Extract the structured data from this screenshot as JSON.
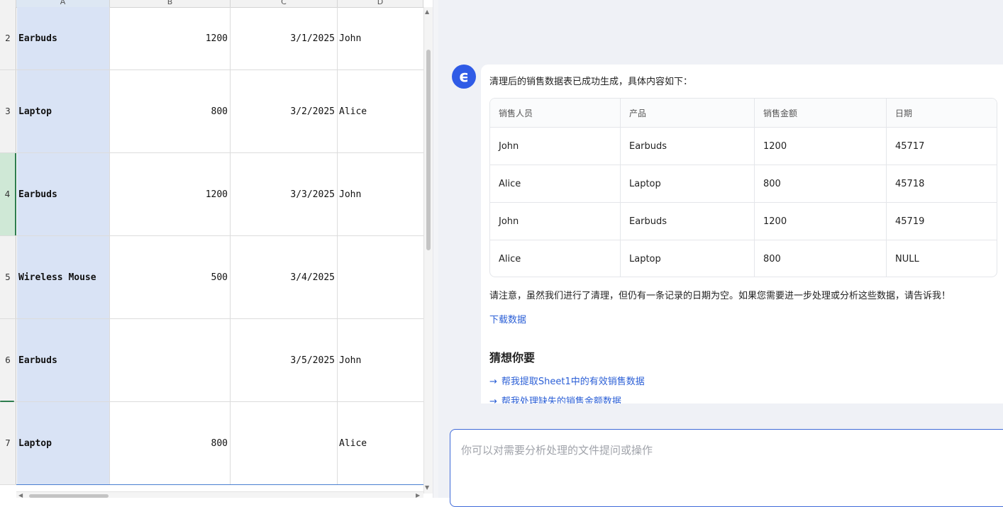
{
  "sheet": {
    "columns": [
      "A",
      "B",
      "C",
      "D"
    ],
    "rows": [
      {
        "num": "2",
        "a": "Earbuds",
        "b": "1200",
        "c": "3/1/2025",
        "d": "John"
      },
      {
        "num": "3",
        "a": "Laptop",
        "b": "800",
        "c": "3/2/2025",
        "d": "Alice"
      },
      {
        "num": "4",
        "a": "Earbuds",
        "b": "1200",
        "c": "3/3/2025",
        "d": "John"
      },
      {
        "num": "5",
        "a": "Wireless Mouse",
        "b": "500",
        "c": "3/4/2025",
        "d": ""
      },
      {
        "num": "6",
        "a": "Earbuds",
        "b": "",
        "c": "3/5/2025",
        "d": "John"
      },
      {
        "num": "7",
        "a": "Laptop",
        "b": "800",
        "c": "",
        "d": "Alice"
      }
    ]
  },
  "chat": {
    "avatar_glyph": "ϵ",
    "intro": "清理后的销售数据表已成功生成，具体内容如下：",
    "table": {
      "headers": [
        "销售人员",
        "产品",
        "销售金额",
        "日期"
      ],
      "rows": [
        [
          "John",
          "Earbuds",
          "1200",
          "45717"
        ],
        [
          "Alice",
          "Laptop",
          "800",
          "45718"
        ],
        [
          "John",
          "Earbuds",
          "1200",
          "45719"
        ],
        [
          "Alice",
          "Laptop",
          "800",
          "NULL"
        ]
      ]
    },
    "note": "请注意，虽然我们进行了清理，但仍有一条记录的日期为空。如果您需要进一步处理或分析这些数据，请告诉我！",
    "download_label": "下载数据",
    "guess_title": "猜想你要",
    "suggestions": [
      {
        "arrow": "→",
        "text": "帮我提取Sheet1中的有效销售数据"
      },
      {
        "arrow": "→",
        "text": "帮我处理缺失的销售金额数据"
      }
    ],
    "input_placeholder": "你可以对需要分析处理的文件提问或操作"
  },
  "colors": {
    "accent": "#2f5be6",
    "link": "#2b5fd6",
    "selection": "#d9e3f5",
    "active_row": "#cfe8d6"
  },
  "icons": {
    "scroll_up": "▲",
    "scroll_down": "▼",
    "scroll_left": "◀",
    "scroll_right": "▶"
  }
}
